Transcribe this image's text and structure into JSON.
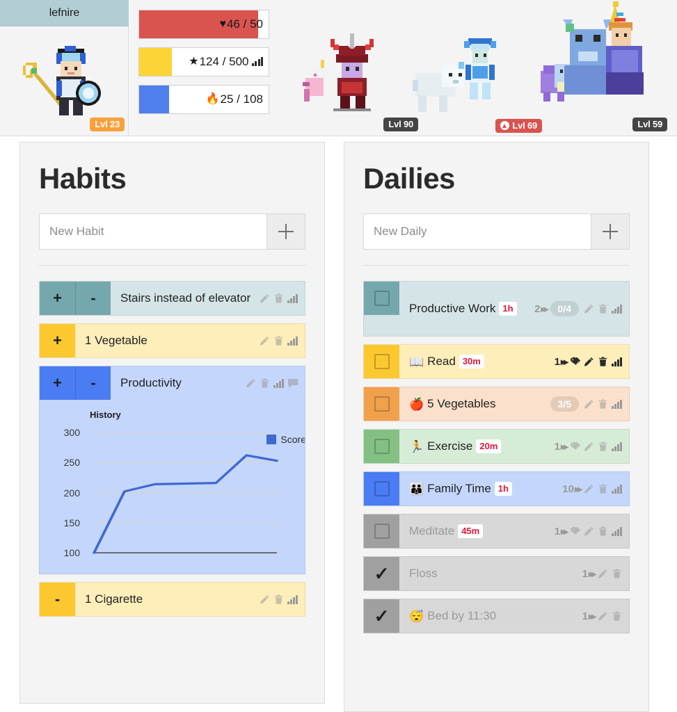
{
  "header": {
    "user": {
      "name": "lefnire",
      "level_label": "Lvl 23",
      "avatar_name": "wizard-avatar-blue-armor"
    },
    "stats": [
      {
        "name": "health",
        "glyph": "♥",
        "value": "46 / 50",
        "current": 46,
        "max": 50,
        "percent": 92,
        "color": "#d9534f",
        "has_chart_icon": false
      },
      {
        "name": "experience",
        "glyph": "★",
        "value": "124 / 500",
        "current": 124,
        "max": 500,
        "percent": 25,
        "color": "#fcd436",
        "has_chart_icon": true
      },
      {
        "name": "mana",
        "glyph": "🔥",
        "value": "25 / 108",
        "current": 25,
        "max": 108,
        "percent": 23,
        "color": "#4f7fed",
        "has_chart_icon": false
      }
    ],
    "party": [
      {
        "name": "party-member-1",
        "level_label": "Lvl 90",
        "badge_style": "dark",
        "level_up": false,
        "avatar_name": "red-candy-cane-mage-with-unicorn-pet"
      },
      {
        "name": "party-member-2",
        "level_label": "Lvl 69",
        "badge_style": "red",
        "level_up": true,
        "avatar_name": "ice-warrior-with-polar-bear-pet"
      },
      {
        "name": "party-member-3",
        "level_label": "Lvl 59",
        "badge_style": "dark",
        "level_up": false,
        "avatar_name": "birthday-hat-rogue-with-dragon-mount"
      }
    ]
  },
  "habits": {
    "title": "Habits",
    "new_placeholder": "New Habit",
    "new_value": "",
    "add_label": "+",
    "items": [
      {
        "title": "Stairs instead of elevator",
        "controls": [
          "+",
          "-"
        ],
        "control_color": "#75a8ad",
        "body_color": "#d5e5e7",
        "icons": [
          "pencil-icon",
          "trash-icon",
          "chart-icon"
        ],
        "has_chart": false
      },
      {
        "title": "1 Vegetable",
        "controls": [
          "+"
        ],
        "control_color": "#fbc830",
        "body_color": "#fdeeba",
        "icons": [
          "pencil-icon",
          "trash-icon",
          "chart-icon"
        ],
        "has_chart": false
      },
      {
        "title": "Productivity",
        "controls": [
          "+",
          "-"
        ],
        "control_color": "#4a7cf3",
        "body_color": "#c4d6fb",
        "icons": [
          "pencil-icon",
          "trash-icon",
          "chart-icon",
          "chat-icon"
        ],
        "has_chart": true
      },
      {
        "title": "1 Cigarette",
        "controls": [
          "-"
        ],
        "control_color": "#fbc830",
        "body_color": "#fdeeba",
        "icons": [
          "pencil-icon",
          "trash-icon",
          "chart-icon"
        ],
        "has_chart": false
      }
    ]
  },
  "chart_data": {
    "type": "line",
    "title": "History",
    "xlabel": "",
    "ylabel": "",
    "ylim": [
      100,
      300
    ],
    "yticks": [
      100,
      150,
      200,
      250,
      300
    ],
    "grid": true,
    "legend_position": "right",
    "series": [
      {
        "name": "Score",
        "color": "#4069d0",
        "x": [
          0,
          1,
          2,
          3,
          4,
          5,
          6
        ],
        "values": [
          100,
          202,
          214,
          215,
          216,
          262,
          253
        ]
      }
    ]
  },
  "dailies": {
    "title": "Dailies",
    "new_placeholder": "New Daily",
    "new_value": "",
    "add_label": "+",
    "items": [
      {
        "title": "Productive Work",
        "emoji": "",
        "time_tag": "1h",
        "streak": "2",
        "checkbox_state": "unchecked",
        "control_color": "#75a8ad",
        "body_color": "#d5e5e7",
        "pill": "0/4",
        "icons": [
          "pencil-icon",
          "trash-icon",
          "chart-icon"
        ],
        "dim": false,
        "two_line": true
      },
      {
        "title": "Read",
        "emoji": "📖",
        "time_tag": "30m",
        "streak": "1",
        "checkbox_state": "unchecked",
        "control_color": "#fbc830",
        "body_color": "#fdeeba",
        "pill": "",
        "icons": [
          "tag-icon",
          "pencil-icon",
          "trash-icon",
          "chart-icon"
        ],
        "dim": false,
        "streak_dark": true,
        "two_line": false
      },
      {
        "title": "5 Vegetables",
        "emoji": "🍎",
        "time_tag": "",
        "streak": "",
        "checkbox_state": "unchecked",
        "control_color": "#f0a14b",
        "body_color": "#fbe0cb",
        "pill": "3/5",
        "icons": [
          "pencil-icon",
          "trash-icon",
          "chart-icon"
        ],
        "dim": false,
        "two_line": false
      },
      {
        "title": "Exercise",
        "emoji": "🏃",
        "time_tag": "20m",
        "streak": "1",
        "checkbox_state": "unchecked",
        "control_color": "#84c084",
        "body_color": "#d6ecd6",
        "pill": "",
        "icons": [
          "tag-icon",
          "pencil-icon",
          "trash-icon",
          "chart-icon"
        ],
        "dim": false,
        "two_line": false
      },
      {
        "title": "Family Time",
        "emoji": "👪",
        "time_tag": "1h",
        "streak": "10",
        "checkbox_state": "unchecked",
        "control_color": "#4a7cf3",
        "body_color": "#c4d6fb",
        "pill": "",
        "icons": [
          "pencil-icon",
          "trash-icon",
          "chart-icon"
        ],
        "dim": false,
        "two_line": false
      },
      {
        "title": "Meditate",
        "emoji": "",
        "time_tag": "45m",
        "streak": "1",
        "checkbox_state": "unchecked",
        "control_color": "#a0a0a0",
        "body_color": "#d8d8d8",
        "pill": "",
        "icons": [
          "tag-icon",
          "pencil-icon",
          "trash-icon",
          "chart-icon"
        ],
        "dim": true,
        "two_line": false
      },
      {
        "title": "Floss",
        "emoji": "",
        "time_tag": "",
        "streak": "1",
        "checkbox_state": "checked",
        "control_color": "#a0a0a0",
        "body_color": "#d8d8d8",
        "pill": "",
        "icons": [
          "pencil-icon",
          "trash-icon"
        ],
        "dim": true,
        "two_line": false
      },
      {
        "title": "Bed by 11:30",
        "emoji": "😴",
        "time_tag": "",
        "streak": "1",
        "checkbox_state": "checked",
        "control_color": "#a0a0a0",
        "body_color": "#d8d8d8",
        "pill": "",
        "icons": [
          "pencil-icon",
          "trash-icon"
        ],
        "dim": true,
        "two_line": false
      }
    ]
  }
}
